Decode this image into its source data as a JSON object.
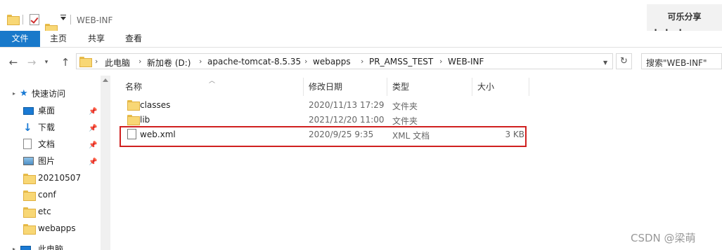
{
  "window": {
    "title": "WEB-INF"
  },
  "watermark": {
    "line1": "可乐分享",
    "line2": "keleshare.cn"
  },
  "ribbon": {
    "tabs": [
      "文件",
      "主页",
      "共享",
      "查看"
    ]
  },
  "address": {
    "crumbs": [
      "此电脑",
      "新加卷 (D:)",
      "apache-tomcat-8.5.35",
      "webapps",
      "PR_AMSS_TEST",
      "WEB-INF"
    ]
  },
  "search": {
    "placeholder": "搜索\"WEB-INF\""
  },
  "navpane": {
    "items": [
      {
        "label": "快速访问",
        "icon": "star-icon"
      },
      {
        "label": "桌面",
        "icon": "desktop-icon",
        "pinned": true
      },
      {
        "label": "下载",
        "icon": "download-icon",
        "pinned": true
      },
      {
        "label": "文档",
        "icon": "document-icon",
        "pinned": true
      },
      {
        "label": "图片",
        "icon": "picture-icon",
        "pinned": true
      },
      {
        "label": "20210507",
        "icon": "folder-icon"
      },
      {
        "label": "conf",
        "icon": "folder-icon"
      },
      {
        "label": "etc",
        "icon": "folder-icon"
      },
      {
        "label": "webapps",
        "icon": "folder-icon"
      },
      {
        "label": "此电脑",
        "icon": "computer-icon"
      }
    ]
  },
  "columns": {
    "name": "名称",
    "date": "修改日期",
    "type": "类型",
    "size": "大小"
  },
  "files": [
    {
      "name": "classes",
      "date": "2020/11/13 17:29",
      "type": "文件夹",
      "size": "",
      "icon": "folder-icon"
    },
    {
      "name": "lib",
      "date": "2021/12/20 11:00",
      "type": "文件夹",
      "size": "",
      "icon": "folder-icon"
    },
    {
      "name": "web.xml",
      "date": "2020/9/25 9:35",
      "type": "XML 文档",
      "size": "3 KB",
      "icon": "xml-file-icon",
      "highlighted": true
    }
  ],
  "credit": "CSDN @梁萌",
  "colors": {
    "accent": "#1979ca",
    "highlight": "#d0201f"
  }
}
